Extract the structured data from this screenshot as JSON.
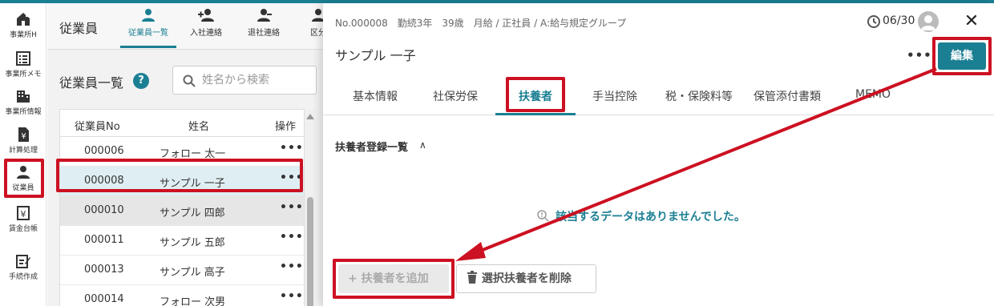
{
  "colors": {
    "accent": "#1b7f93",
    "highlight": "#cc1122"
  },
  "left_nav": {
    "items": [
      {
        "label": "事業所H",
        "icon": "office-home-icon"
      },
      {
        "label": "事業所メモ",
        "icon": "memo-list-icon"
      },
      {
        "label": "事業所情報",
        "icon": "building-icon"
      },
      {
        "label": "計算処理",
        "icon": "yen-document-icon"
      },
      {
        "label": "従業員",
        "icon": "person-icon"
      },
      {
        "label": "賃金台帳",
        "icon": "yen-ledger-icon"
      },
      {
        "label": "手続作成",
        "icon": "edit-document-icon"
      }
    ],
    "active": "従業員"
  },
  "employee_pane": {
    "title": "従業員",
    "subtabs": [
      {
        "label": "従業員一覧",
        "icon": "person-icon"
      },
      {
        "label": "入社連絡",
        "icon": "person-add-icon"
      },
      {
        "label": "退社連絡",
        "icon": "person-remove-icon"
      },
      {
        "label": "区分",
        "icon": "person-icon"
      }
    ],
    "list_title": "従業員一覧",
    "search_placeholder": "姓名から検索",
    "table": {
      "headers": {
        "no": "従業員No",
        "name": "姓名",
        "op": "操作"
      },
      "rows": [
        {
          "no": "000006",
          "name": "フォロー 太一",
          "op": "•••"
        },
        {
          "no": "000008",
          "name": "サンプル 一子",
          "op": "•••"
        },
        {
          "no": "000010",
          "name": "サンプル 四郎",
          "op": "•••"
        },
        {
          "no": "000011",
          "name": "サンプル 五郎",
          "op": "•••"
        },
        {
          "no": "000013",
          "name": "サンプル 高子",
          "op": "•••"
        },
        {
          "no": "000014",
          "name": "フォロー 次男",
          "op": "•••"
        }
      ],
      "selected_no": "000008"
    }
  },
  "detail": {
    "meta": "No.000008　勤続3年　39歳　月給 / 正社員 / A:給与規定グループ",
    "date": "06/30",
    "close": "✕",
    "name": "サンプル 一子",
    "more": "•••",
    "edit_label": "編集",
    "tabs": [
      "基本情報",
      "社保労保",
      "扶養者",
      "手当控除",
      "税・保険料等",
      "保管添付書類",
      "MEMO"
    ],
    "active_tab": "扶養者",
    "section_title": "扶養者登録一覧",
    "section_chevron": "∧",
    "empty_message": "該当するデータはありませんでした。",
    "add_button": "扶養者を追加",
    "add_icon": "+",
    "delete_button": "選択扶養者を削除"
  }
}
